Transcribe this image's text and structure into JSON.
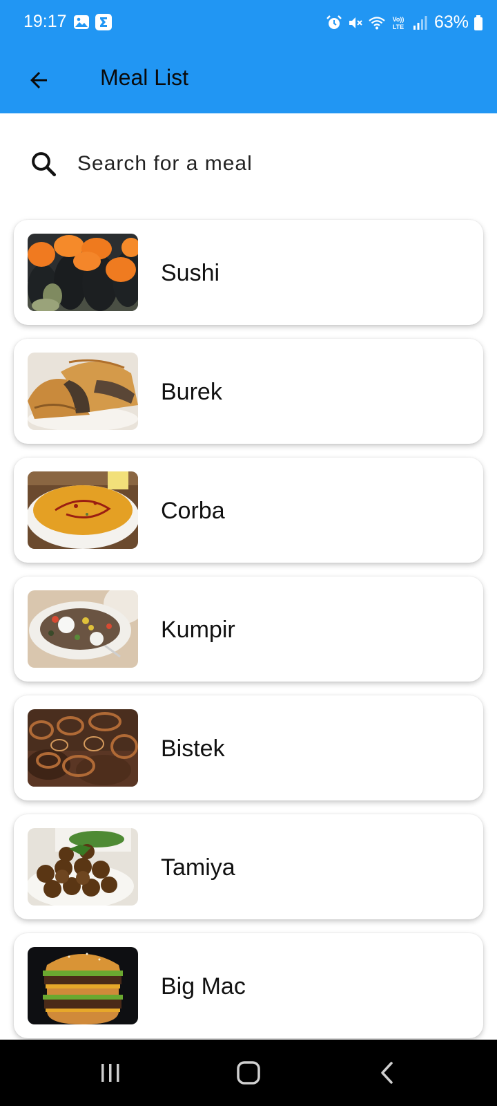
{
  "status_bar": {
    "time": "19:17",
    "battery": "63%",
    "left_icons": [
      "gallery-notification-icon",
      "sigma-app-icon"
    ],
    "right_icons": [
      "alarm-icon",
      "mute-icon",
      "wifi-icon",
      "volte-icon",
      "signal-icon",
      "battery-icon"
    ]
  },
  "app_bar": {
    "title": "Meal List",
    "back_icon": "arrow-back-icon",
    "background": "#2196f3"
  },
  "search": {
    "placeholder": "Search for a meal",
    "value": "",
    "icon": "search-icon"
  },
  "meals": [
    {
      "name": "Sushi"
    },
    {
      "name": "Burek"
    },
    {
      "name": "Corba"
    },
    {
      "name": "Kumpir"
    },
    {
      "name": "Bistek"
    },
    {
      "name": "Tamiya"
    },
    {
      "name": "Big Mac"
    }
  ],
  "nav_bar": {
    "buttons": [
      "recents-icon",
      "home-icon",
      "back-icon"
    ]
  }
}
